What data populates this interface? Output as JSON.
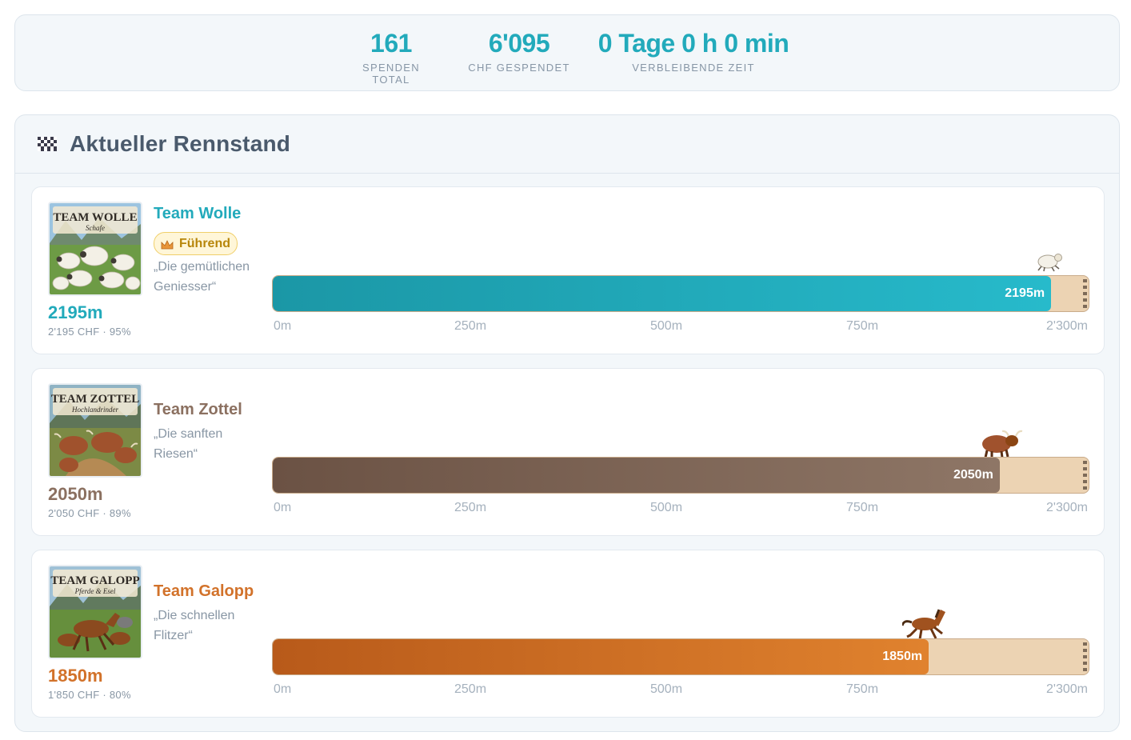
{
  "stats": [
    {
      "value": "161",
      "label": "SPENDEN TOTAL"
    },
    {
      "value": "6'095",
      "label": "CHF GESPENDET"
    },
    {
      "value": "0 Tage 0 h 0 min",
      "label": "VERBLEIBENDE ZEIT"
    }
  ],
  "race": {
    "icon": "checkered-flag-icon",
    "title": "Aktueller Rennstand",
    "goal_m": 2300,
    "ticks": [
      "0m",
      "250m",
      "500m",
      "750m",
      "2'300m"
    ]
  },
  "teams": [
    {
      "name": "Team Wolle",
      "image_title": "TEAM WOLLE",
      "image_subtitle": "Schafe",
      "badge": "Führend",
      "badge_icon": "crown-icon",
      "tagline": "„Die gemütlichen Geniesser“",
      "distance": "2195m",
      "meta": "2'195 CHF · 95%",
      "progress_fraction": 0.954,
      "runner_icon": "sheep-icon",
      "color": "#22aabb"
    },
    {
      "name": "Team Zottel",
      "image_title": "TEAM ZOTTEL",
      "image_subtitle": "Hochlandrinder",
      "tagline": "„Die sanften Riesen“",
      "distance": "2050m",
      "meta": "2'050 CHF · 89%",
      "progress_fraction": 0.891,
      "runner_icon": "highland-cow-icon",
      "color": "#8b7060"
    },
    {
      "name": "Team Galopp",
      "image_title": "TEAM GALOPP",
      "image_subtitle": "Pferde & Esel",
      "tagline": "„Die schnellen Flitzer“",
      "distance": "1850m",
      "meta": "1'850 CHF · 80%",
      "progress_fraction": 0.804,
      "runner_icon": "horse-icon",
      "color": "#d2722a"
    }
  ]
}
